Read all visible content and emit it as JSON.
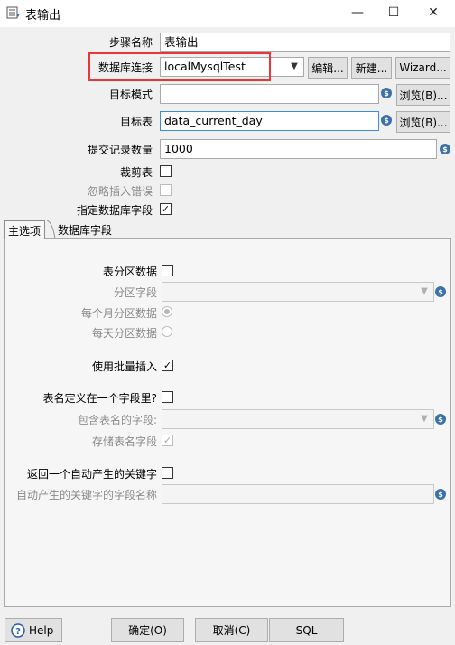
{
  "window": {
    "title": "表输出",
    "minimize": "—",
    "maximize": "☐",
    "close": "✕"
  },
  "fields": {
    "step_name_label": "步骤名称",
    "step_name_value": "表输出",
    "db_connection_label": "数据库连接",
    "db_connection_value": "localMysqlTest",
    "edit_button": "编辑...",
    "new_button": "新建...",
    "wizard_button": "Wizard...",
    "target_schema_label": "目标模式",
    "target_schema_value": "",
    "browse_schema_button": "浏览(B)...",
    "target_table_label": "目标表",
    "target_table_value": "data_current_day",
    "browse_table_button": "浏览(B)...",
    "commit_size_label": "提交记录数量",
    "commit_size_value": "1000",
    "truncate_label": "裁剪表",
    "truncate_checked": false,
    "ignore_errors_label": "忽略插入错误",
    "ignore_errors_checked": false,
    "specify_fields_label": "指定数据库字段",
    "specify_fields_checked": true,
    "variable_icon_glyph": "$"
  },
  "tabs": [
    {
      "label": "主选项",
      "active": true
    },
    {
      "label": "数据库字段",
      "active": false
    }
  ],
  "main_tab": {
    "partition_label": "表分区数据",
    "partition_checked": false,
    "partition_field_label": "分区字段",
    "partition_field_value": "",
    "monthly_label": "每个月分区数据",
    "monthly_selected": true,
    "daily_label": "每天分区数据",
    "daily_selected": false,
    "batch_insert_label": "使用批量插入",
    "batch_insert_checked": true,
    "table_in_field_label": "表名定义在一个字段里?",
    "table_in_field_checked": false,
    "table_name_field_label": "包含表名的字段:",
    "table_name_field_value": "",
    "store_table_name_label": "存储表名字段",
    "store_table_name_checked": true,
    "return_key_label": "返回一个自动产生的关键字",
    "return_key_checked": false,
    "key_field_name_label": "自动产生的关键字的字段名称",
    "key_field_name_value": ""
  },
  "footer": {
    "help_button": "Help",
    "ok_button": "确定(O)",
    "cancel_button": "取消(C)",
    "sql_button": "SQL"
  },
  "colors": {
    "highlight": "#e8363b",
    "variable_icon": "#3d72a8",
    "focus_border": "#3c8cd8"
  }
}
